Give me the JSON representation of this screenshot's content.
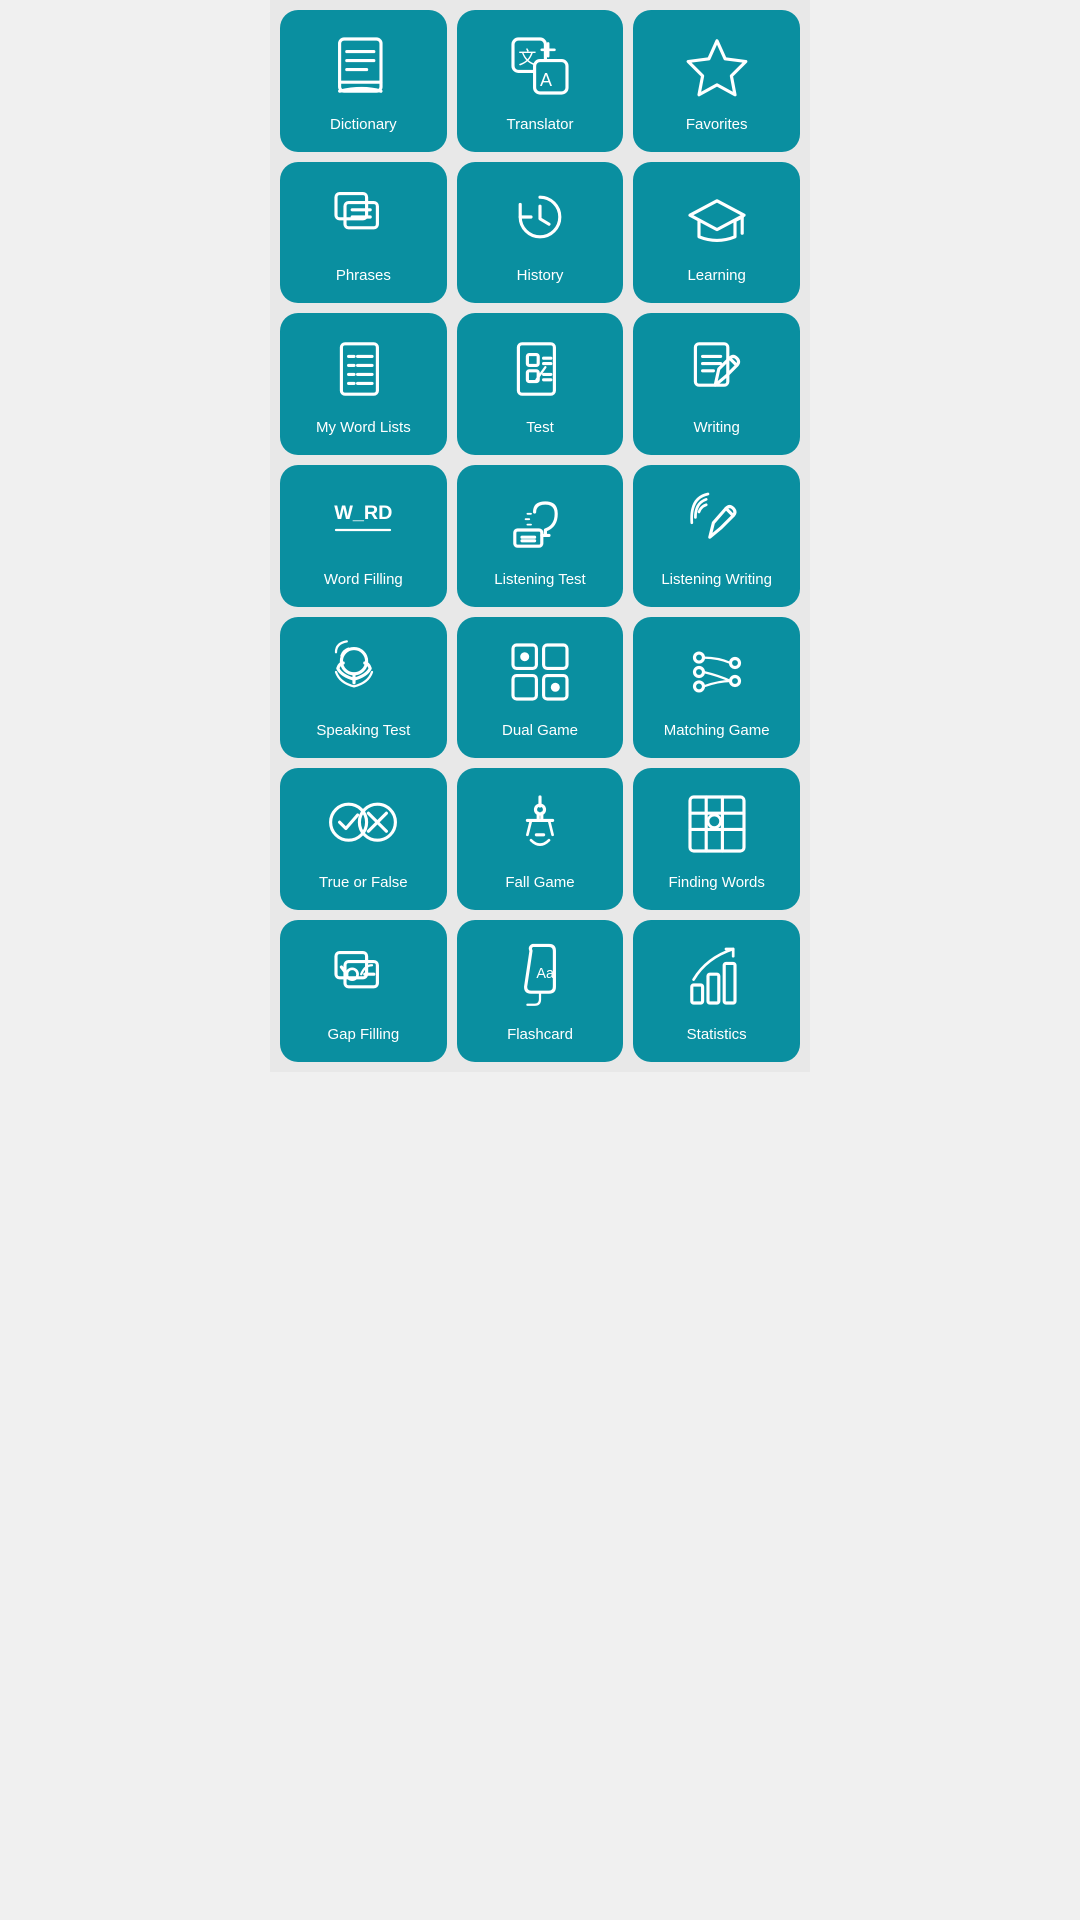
{
  "cards": [
    {
      "id": "dictionary",
      "label": "Dictionary",
      "icon": "dictionary"
    },
    {
      "id": "translator",
      "label": "Translator",
      "icon": "translator"
    },
    {
      "id": "favorites",
      "label": "Favorites",
      "icon": "favorites"
    },
    {
      "id": "phrases",
      "label": "Phrases",
      "icon": "phrases"
    },
    {
      "id": "history",
      "label": "History",
      "icon": "history"
    },
    {
      "id": "learning",
      "label": "Learning",
      "icon": "learning"
    },
    {
      "id": "my-word-lists",
      "label": "My Word Lists",
      "icon": "wordlists"
    },
    {
      "id": "test",
      "label": "Test",
      "icon": "test"
    },
    {
      "id": "writing",
      "label": "Writing",
      "icon": "writing"
    },
    {
      "id": "word-filling",
      "label": "Word Filling",
      "icon": "wordfilling"
    },
    {
      "id": "listening-test",
      "label": "Listening Test",
      "icon": "listeningtest"
    },
    {
      "id": "listening-writing",
      "label": "Listening Writing",
      "icon": "listeningwriting"
    },
    {
      "id": "speaking-test",
      "label": "Speaking Test",
      "icon": "speakingtest"
    },
    {
      "id": "dual-game",
      "label": "Dual Game",
      "icon": "dualgame"
    },
    {
      "id": "matching-game",
      "label": "Matching Game",
      "icon": "matchinggame"
    },
    {
      "id": "true-or-false",
      "label": "True or False",
      "icon": "trueorfalse"
    },
    {
      "id": "fall-game",
      "label": "Fall Game",
      "icon": "fallgame"
    },
    {
      "id": "finding-words",
      "label": "Finding Words",
      "icon": "findingwords"
    },
    {
      "id": "gap-filling",
      "label": "Gap Filling",
      "icon": "gapfilling"
    },
    {
      "id": "flashcard",
      "label": "Flashcard",
      "icon": "flashcard"
    },
    {
      "id": "statistics",
      "label": "Statistics",
      "icon": "statistics"
    }
  ]
}
